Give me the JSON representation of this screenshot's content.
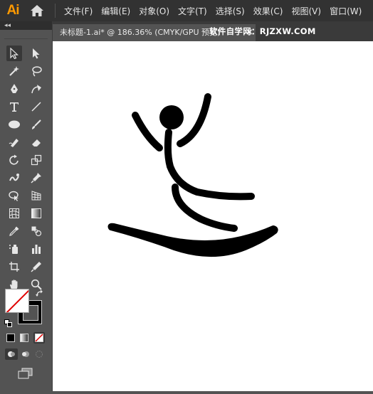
{
  "app": {
    "logo_text": "Ai"
  },
  "menu": [
    {
      "id": "file",
      "label": "文件(F)"
    },
    {
      "id": "edit",
      "label": "编辑(E)"
    },
    {
      "id": "object",
      "label": "对象(O)"
    },
    {
      "id": "type",
      "label": "文字(T)"
    },
    {
      "id": "select",
      "label": "选择(S)"
    },
    {
      "id": "effect",
      "label": "效果(C)"
    },
    {
      "id": "view",
      "label": "视图(V)"
    },
    {
      "id": "window",
      "label": "窗口(W)"
    }
  ],
  "toolbox": {
    "collapse_glyph": "◂◂"
  },
  "document_tab": {
    "title": "未标题-1.ai* @ 186.36% (CMYK/GPU 预览)",
    "close_glyph": "×"
  },
  "watermark": "软件自学网：RJZXW.COM",
  "colors": {
    "menubar": "#323232",
    "panel": "#535353",
    "canvas": "#ffffff",
    "logo": "#ff9a00",
    "artwork": "#000000",
    "none_swatch_slash": "#e00000"
  }
}
